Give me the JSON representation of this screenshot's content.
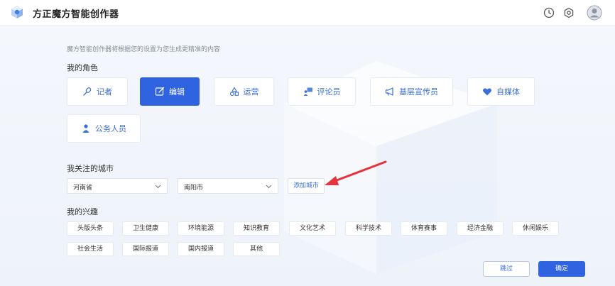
{
  "app": {
    "title": "方正魔方智能创作器"
  },
  "icons": {
    "logo": "cube-logo-icon",
    "history": "history-icon",
    "settings": "gear-icon",
    "avatar": "user-avatar-icon"
  },
  "hint": "魔方智能创作器将根据您的设置为您生成更精准的内容",
  "roles": {
    "label": "我的角色",
    "selected": "编辑",
    "items": [
      {
        "label": "记者",
        "icon": "microphone-icon"
      },
      {
        "label": "编辑",
        "icon": "edit-icon"
      },
      {
        "label": "运营",
        "icon": "shapes-icon"
      },
      {
        "label": "评论员",
        "icon": "presenter-icon"
      },
      {
        "label": "基层宣传员",
        "icon": "megaphone-icon"
      },
      {
        "label": "自媒体",
        "icon": "heart-chat-icon"
      },
      {
        "label": "公务人员",
        "icon": "person-icon"
      }
    ]
  },
  "city": {
    "label": "我关注的城市",
    "province": "河南省",
    "city": "南阳市",
    "add_label": "添加城市"
  },
  "interests": {
    "label": "我的兴趣",
    "items": [
      "头版头条",
      "卫生健康",
      "环境能源",
      "知识教育",
      "文化艺术",
      "科学技术",
      "体育赛事",
      "经济金融",
      "休闲娱乐",
      "社会生活",
      "国际报道",
      "国内报道",
      "其他"
    ]
  },
  "actions": {
    "skip": "跳过",
    "confirm": "确定"
  },
  "colors": {
    "accent": "#2f63e0",
    "annotation_arrow": "#e8323c"
  }
}
